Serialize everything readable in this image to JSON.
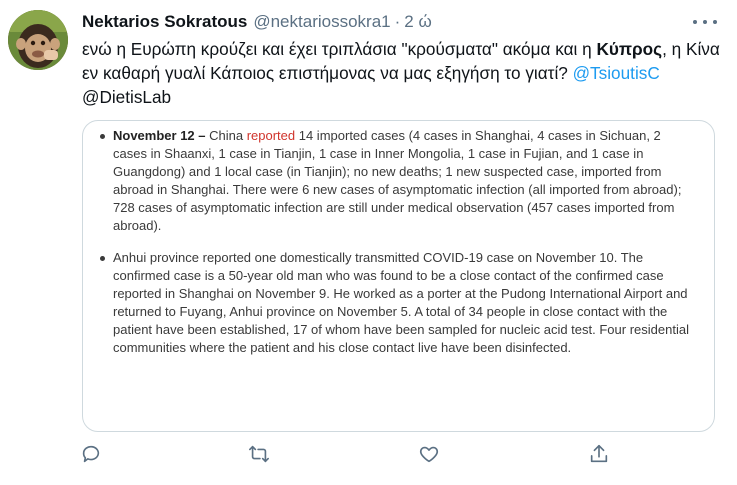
{
  "tweet": {
    "author_name": "Nektarios Sokratous",
    "handle": "@nektariossokra1",
    "separator": "·",
    "time": "2 ώ",
    "text_part1": "ενώ η Ευρώπη κρούζει και έχει τριπλάσια \"κρούσματα\" ακόμα και η ",
    "text_bold": "Κύπρος",
    "text_part2": ", η Κίνα εν καθαρή γυαλί Κάποιος επιστήμονας να μας εξηγήση το γιατί? ",
    "mention1": "@TsioutisC",
    "mention2": "@DietisLab"
  },
  "embed": {
    "item1_date": "November 12 –",
    "item1_pre": " China ",
    "item1_red": "reported",
    "item1_rest": " 14 imported cases (4 cases in Shanghai, 4 cases in Sichuan, 2 cases in Shaanxi, 1 case in Tianjin, 1 case in Inner Mongolia, 1 case in Fujian, and 1 case in Guangdong) and 1 local case (in Tianjin); no new deaths; 1 new suspected case, imported from abroad in Shanghai. There were 6 new cases of asymptomatic infection (all imported from abroad); 728 cases of asymptomatic infection are still under medical observation (457 cases imported from abroad).",
    "item2": "Anhui province reported one domestically transmitted COVID-19 case on November 10. The confirmed case is a 50-year old man who was found to be a close contact of the confirmed case reported in Shanghai on November 9. He worked as a porter at the Pudong International Airport and returned to Fuyang, Anhui province on November 5. A total of 34 people in close contact with the patient have been established, 17 of whom have been sampled for nucleic acid test. Four residential communities where the patient and his close contact live have been disinfected."
  },
  "icons": [
    "reply-icon",
    "retweet-icon",
    "like-icon",
    "share-icon",
    "more-icon"
  ],
  "colors": {
    "link": "#1d9bf0",
    "muted": "#5b7083",
    "reported_red": "#d0342c"
  }
}
